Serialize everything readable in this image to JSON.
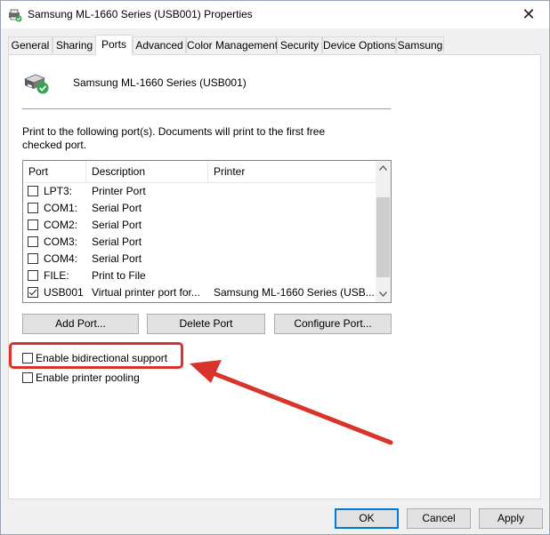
{
  "window": {
    "title": "Samsung ML-1660 Series (USB001) Properties",
    "close_glyph": "✕"
  },
  "tabs": [
    {
      "label": "General",
      "active": false
    },
    {
      "label": "Sharing",
      "active": false
    },
    {
      "label": "Ports",
      "active": true
    },
    {
      "label": "Advanced",
      "active": false
    },
    {
      "label": "Color Management",
      "active": false
    },
    {
      "label": "Security",
      "active": false
    },
    {
      "label": "Device Options",
      "active": false
    },
    {
      "label": "Samsung",
      "active": false
    }
  ],
  "ports_tab": {
    "printer_name": "Samsung ML-1660 Series (USB001)",
    "intro_text": "Print to the following port(s). Documents will print to the first free checked port.",
    "columns": {
      "port": "Port",
      "description": "Description",
      "printer": "Printer"
    },
    "rows": [
      {
        "port": "LPT3:",
        "description": "Printer Port",
        "printer": "",
        "checked": false
      },
      {
        "port": "COM1:",
        "description": "Serial Port",
        "printer": "",
        "checked": false
      },
      {
        "port": "COM2:",
        "description": "Serial Port",
        "printer": "",
        "checked": false
      },
      {
        "port": "COM3:",
        "description": "Serial Port",
        "printer": "",
        "checked": false
      },
      {
        "port": "COM4:",
        "description": "Serial Port",
        "printer": "",
        "checked": false
      },
      {
        "port": "FILE:",
        "description": "Print to File",
        "printer": "",
        "checked": false
      },
      {
        "port": "USB001",
        "description": "Virtual printer port for...",
        "printer": "Samsung ML-1660 Series (USB...",
        "checked": true
      }
    ],
    "buttons": {
      "add_port": "Add Port...",
      "delete_port": "Delete Port",
      "configure_port": "Configure Port..."
    },
    "options": {
      "bidirectional": {
        "label": "Enable bidirectional support",
        "checked": false
      },
      "pooling": {
        "label": "Enable printer pooling",
        "checked": false
      }
    }
  },
  "footer": {
    "ok": "OK",
    "cancel": "Cancel",
    "apply": "Apply"
  },
  "annotation": {
    "color": "#d9342b"
  },
  "colors": {
    "accent": "#0078d7",
    "status_ok": "#2fa84f"
  },
  "icons": {
    "title": "printer-icon",
    "printer": "printer-ready-icon",
    "scroll_up": "chevron-up-icon",
    "scroll_down": "chevron-down-icon"
  }
}
